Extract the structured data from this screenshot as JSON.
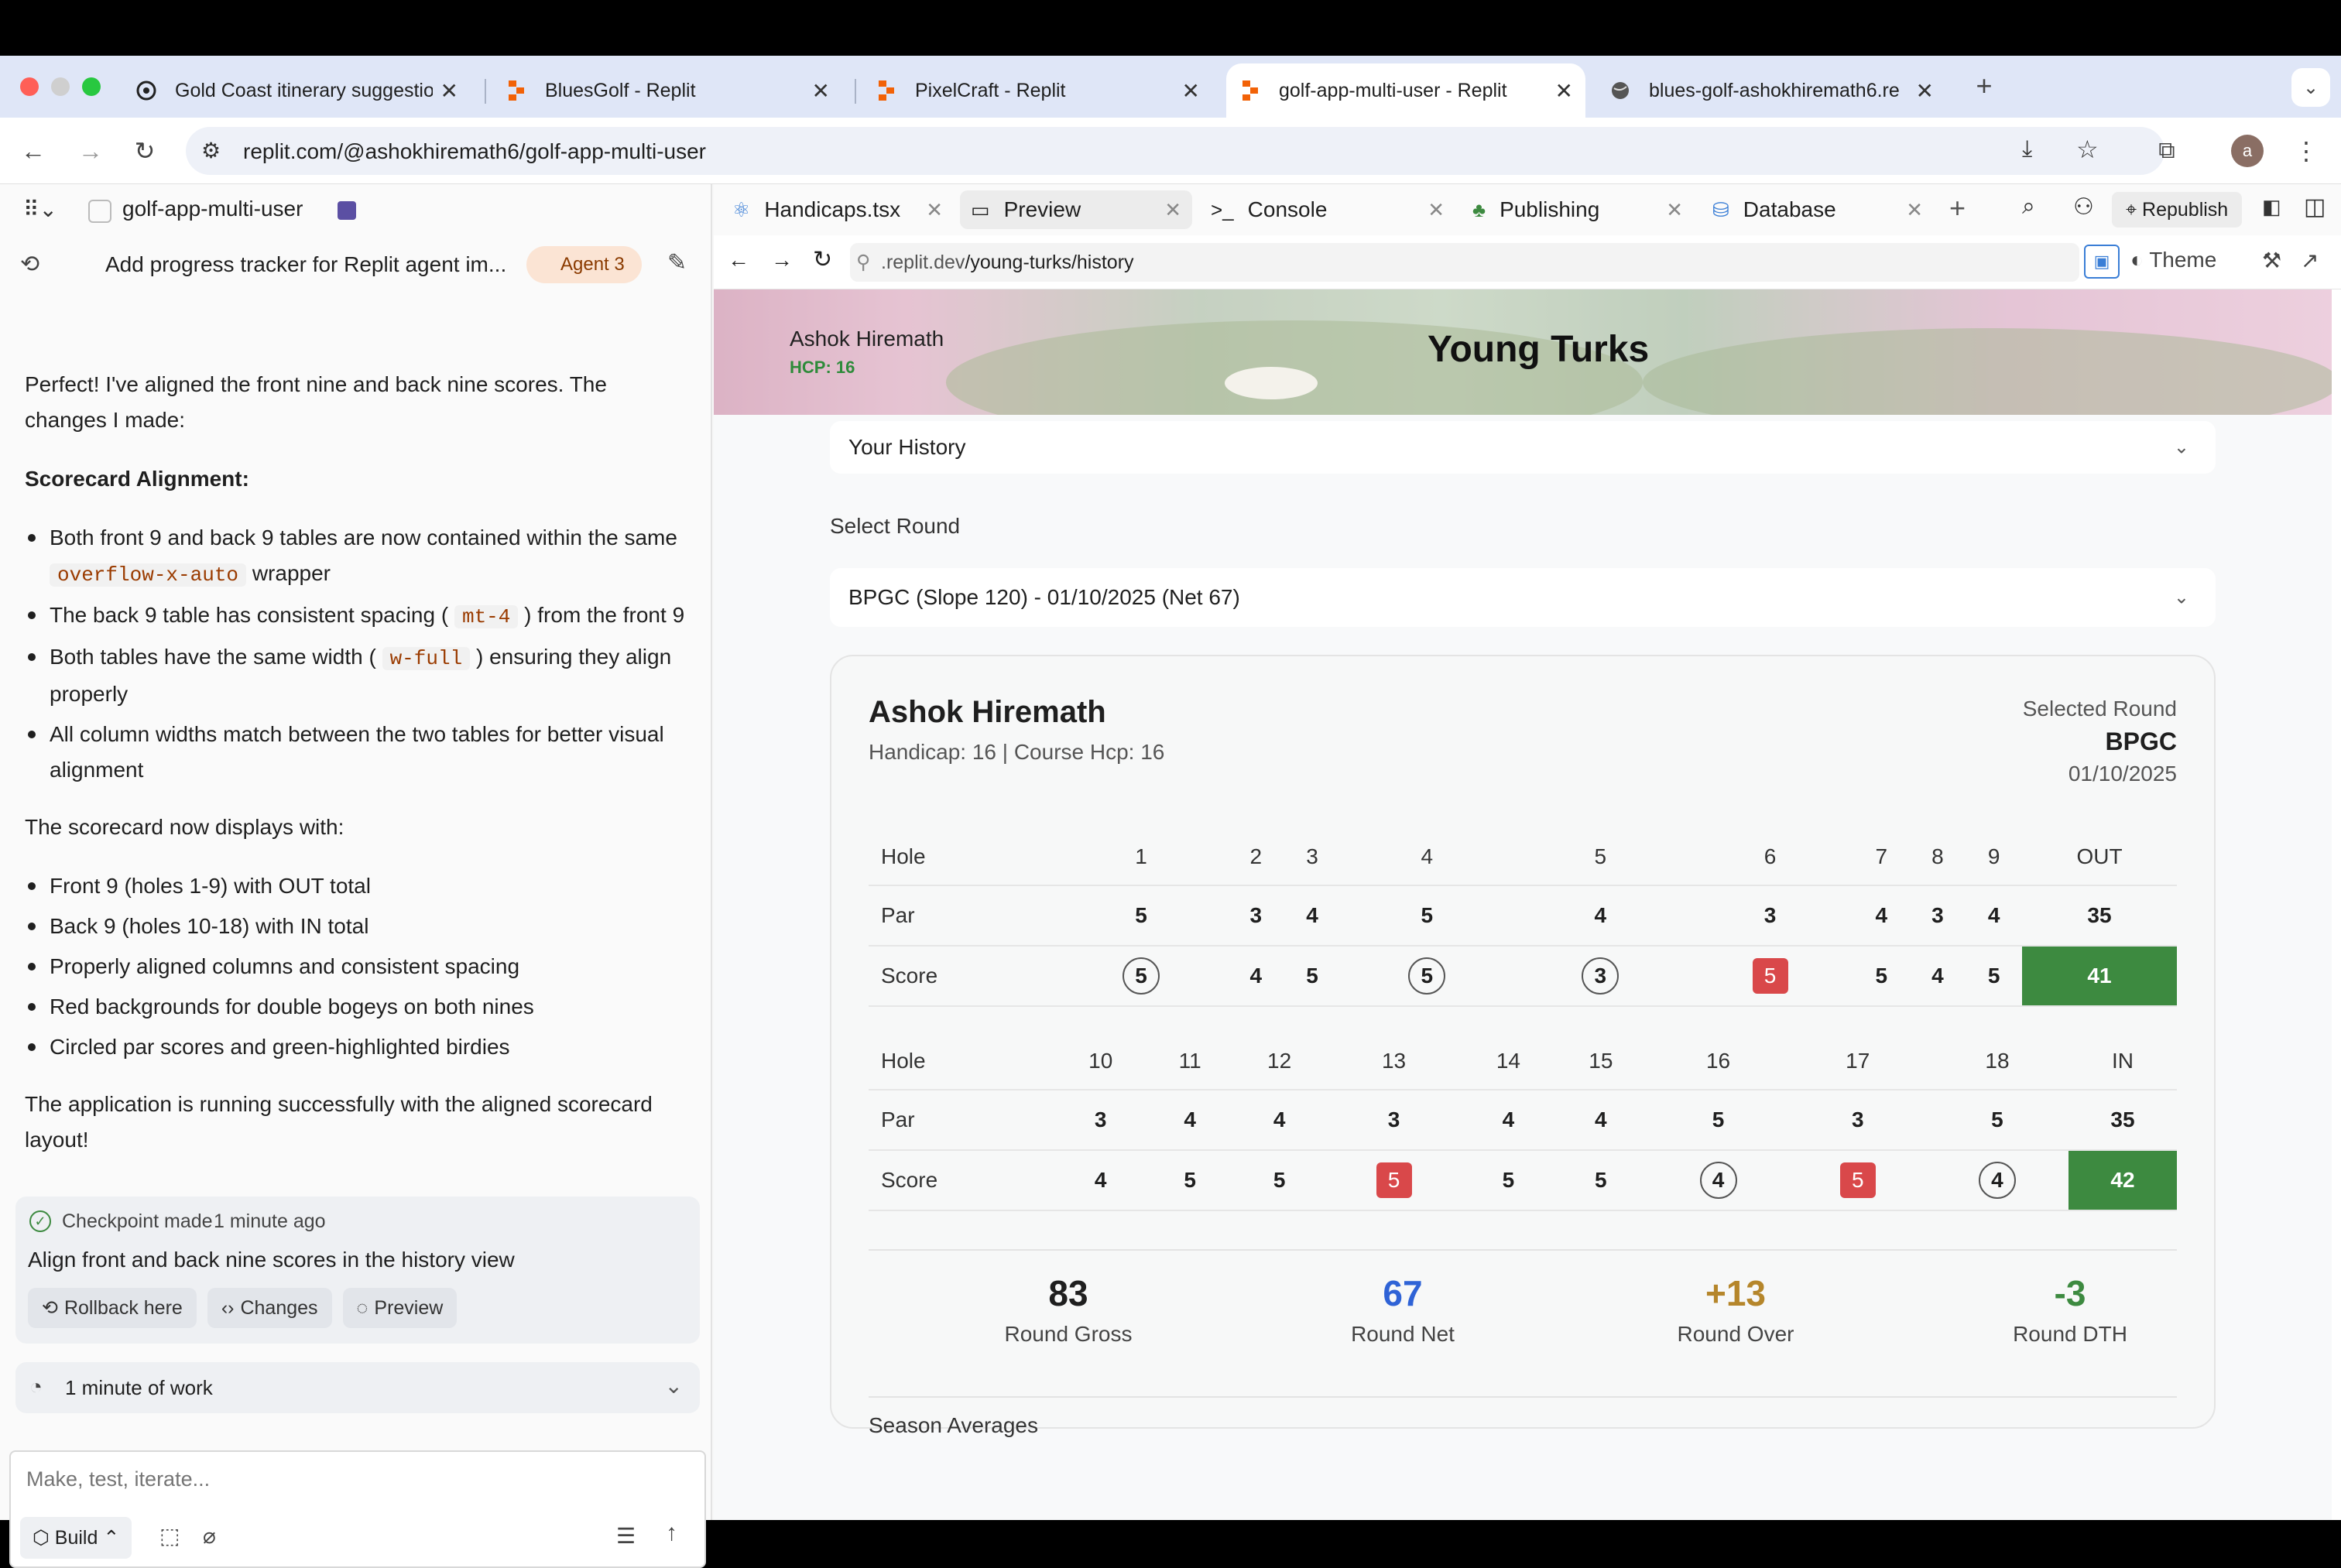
{
  "browser": {
    "tabs": [
      {
        "title": "Gold Coast itinerary suggestio",
        "icon": "openai-icon"
      },
      {
        "title": "BluesGolf - Replit",
        "icon": "replit-icon"
      },
      {
        "title": "PixelCraft - Replit",
        "icon": "replit-icon"
      },
      {
        "title": "golf-app-multi-user - Replit",
        "icon": "replit-icon"
      },
      {
        "title": "blues-golf-ashokhiremath6.re",
        "icon": "globe-icon"
      }
    ],
    "url": "replit.com/@ashokhiremath6/golf-app-multi-user",
    "avatar_letter": "a"
  },
  "workspace": {
    "project_name": "golf-app-multi-user",
    "chat_title": "Add progress tracker for Replit agent im...",
    "agent_badge": "Agent 3",
    "messages": {
      "intro": "Perfect! I've aligned the front nine and back nine scores. The changes I made:",
      "section_title": "Scorecard Alignment:",
      "bullets1": {
        "b1_pre": "Both front 9 and back 9 tables are now contained within the same",
        "b1_code": "overflow-x-auto",
        "b1_post": "wrapper",
        "b2_pre": "The back 9 table has consistent spacing (",
        "b2_code": "mt-4",
        "b2_post": ") from the front 9",
        "b3_pre": "Both tables have the same width (",
        "b3_code": "w-full",
        "b3_post": ") ensuring they align properly",
        "b4": "All column widths match between the two tables for better visual alignment"
      },
      "displays_with": "The scorecard now displays with:",
      "bullets2": [
        "Front 9 (holes 1-9) with OUT total",
        "Back 9 (holes 10-18) with IN total",
        "Properly aligned columns and consistent spacing",
        "Red backgrounds for double bogeys on both nines",
        "Circled par scores and green-highlighted birdies"
      ],
      "closing": "The application is running successfully with the aligned scorecard layout!"
    },
    "checkpoint": {
      "label": "Checkpoint made",
      "time": "1 minute ago",
      "title": "Align front and back nine scores in the history view",
      "rollback": "Rollback here",
      "changes": "Changes",
      "preview": "Preview"
    },
    "work_time": "1 minute of work",
    "input_placeholder": "Make, test, iterate...",
    "build_label": "Build"
  },
  "right_tabs": [
    {
      "label": "Handicaps.tsx",
      "icon": "react-icon"
    },
    {
      "label": "Preview",
      "icon": "monitor-icon"
    },
    {
      "label": "Console",
      "icon": "terminal-icon"
    },
    {
      "label": "Publishing",
      "icon": "tree-icon"
    },
    {
      "label": "Database",
      "icon": "database-icon"
    }
  ],
  "republish_label": "Republish",
  "preview": {
    "url_prefix": ".replit.dev",
    "url_path": "/young-turks/history",
    "theme_label": "Theme"
  },
  "app": {
    "user_name": "Ashok Hiremath",
    "user_hcp": "HCP: 16",
    "group_name": "Young Turks",
    "view_select": "Your History",
    "select_round_label": "Select Round",
    "round_select": "BPGC (Slope 120) - 01/10/2025 (Net 67)",
    "scorecard": {
      "player": "Ashok Hiremath",
      "handicap_line": "Handicap: 16 | Course Hcp: 16",
      "selected_round_label": "Selected Round",
      "course": "BPGC",
      "date": "01/10/2025",
      "front": {
        "holes": [
          "1",
          "2",
          "3",
          "4",
          "5",
          "6",
          "7",
          "8",
          "9"
        ],
        "par": [
          "5",
          "3",
          "4",
          "5",
          "4",
          "3",
          "4",
          "3",
          "4"
        ],
        "score": [
          "5",
          "4",
          "5",
          "5",
          "3",
          "5",
          "5",
          "4",
          "5"
        ],
        "score_style": [
          "circle",
          "plain",
          "plain",
          "circle",
          "circle",
          "double",
          "plain",
          "plain",
          "plain"
        ],
        "total_label": "OUT",
        "par_total": "35",
        "score_total": "41"
      },
      "back": {
        "holes": [
          "10",
          "11",
          "12",
          "13",
          "14",
          "15",
          "16",
          "17",
          "18"
        ],
        "par": [
          "3",
          "4",
          "4",
          "3",
          "4",
          "4",
          "5",
          "3",
          "5"
        ],
        "score": [
          "4",
          "5",
          "5",
          "5",
          "5",
          "5",
          "4",
          "5",
          "4"
        ],
        "score_style": [
          "plain",
          "plain",
          "plain",
          "double",
          "plain",
          "plain",
          "circle",
          "double",
          "circle"
        ],
        "total_label": "IN",
        "par_total": "35",
        "score_total": "42"
      },
      "row_labels": {
        "hole": "Hole",
        "par": "Par",
        "score": "Score"
      },
      "stats": [
        {
          "value": "83",
          "label": "Round Gross",
          "color": "#1f1f1f"
        },
        {
          "value": "67",
          "label": "Round Net",
          "color": "#2f63d6"
        },
        {
          "value": "+13",
          "label": "Round Over",
          "color": "#b5862b"
        },
        {
          "value": "-3",
          "label": "Round DTH",
          "color": "#3d8a40"
        }
      ],
      "season_averages": "Season Averages"
    }
  }
}
